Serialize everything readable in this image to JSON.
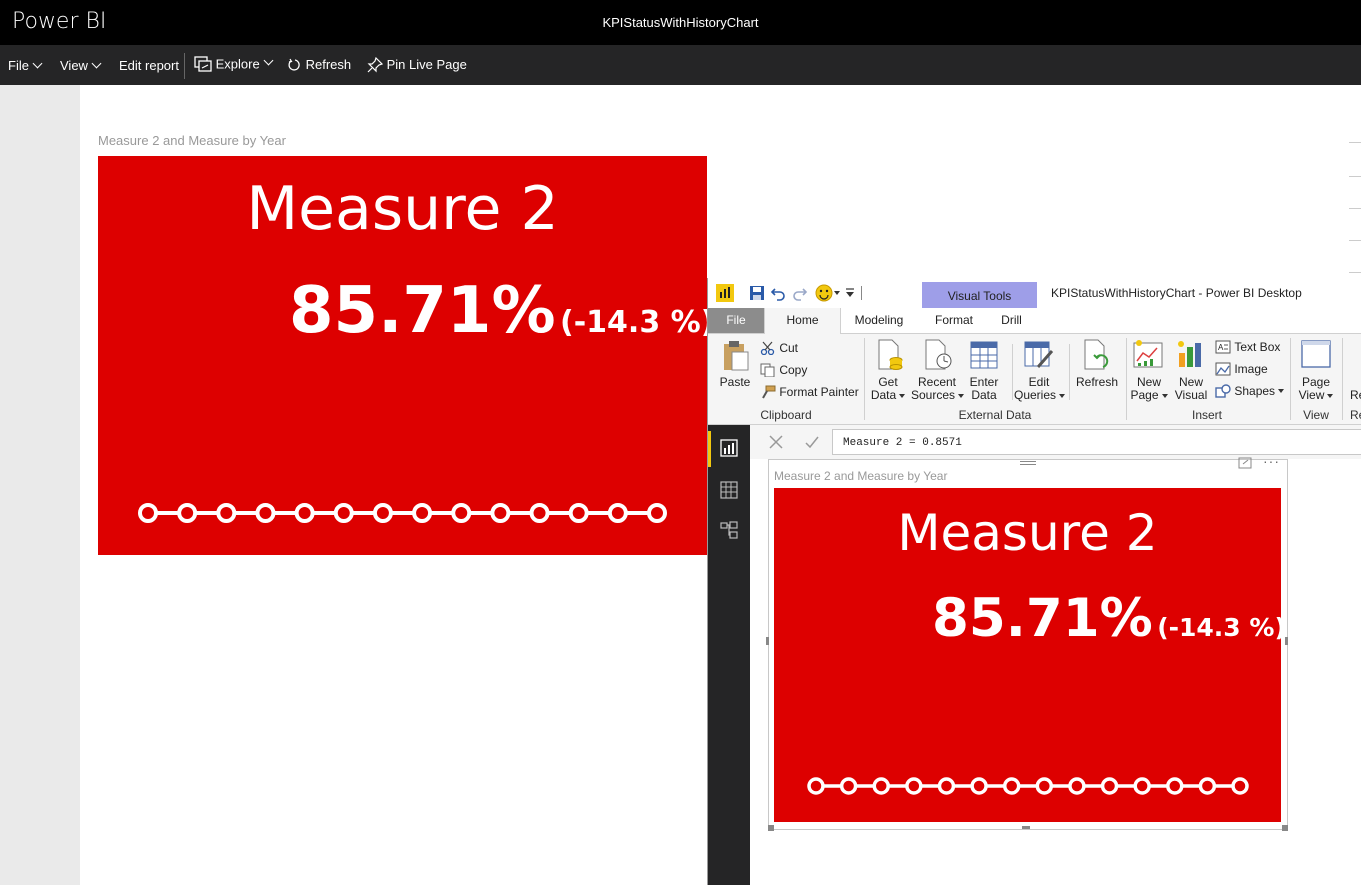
{
  "titlebar": {
    "app_name": "Power BI",
    "report_title": "KPIStatusWithHistoryChart"
  },
  "menubar": {
    "file": "File",
    "view": "View",
    "edit_report": "Edit report",
    "explore": "Explore",
    "refresh": "Refresh",
    "pin_live_page": "Pin Live Page"
  },
  "visual": {
    "title": "Measure 2 and Measure by Year",
    "card_title": "Measure 2",
    "value": "85.71%",
    "change": "(-14.3 %)",
    "history_points": 14,
    "color": "#dd0000"
  },
  "desktop": {
    "title": "KPIStatusWithHistoryChart - Power BI Desktop",
    "contextual_tab": "Visual Tools",
    "tabs": {
      "file": "File",
      "home": "Home",
      "modeling": "Modeling",
      "format": "Format",
      "drill": "Drill"
    },
    "ribbon": {
      "paste": "Paste",
      "cut": "Cut",
      "copy": "Copy",
      "format_painter": "Format Painter",
      "clipboard": "Clipboard",
      "get_data_1": "Get",
      "get_data_2": "Data",
      "recent_1": "Recent",
      "recent_2": "Sources",
      "enter_1": "Enter",
      "enter_2": "Data",
      "edit_1": "Edit",
      "edit_2": "Queries",
      "refresh": "Refresh",
      "external_data": "External Data",
      "new_page_1": "New",
      "new_page_2": "Page",
      "new_visual_1": "New",
      "new_visual_2": "Visual",
      "text_box": "Text Box",
      "image": "Image",
      "shapes": "Shapes",
      "insert": "Insert",
      "page_view_1": "Page",
      "page_view_2": "View",
      "view": "View",
      "cut_off_1": "Re",
      "cut_off_2": "Re"
    },
    "formula": "Measure 2 = 0.8571"
  }
}
